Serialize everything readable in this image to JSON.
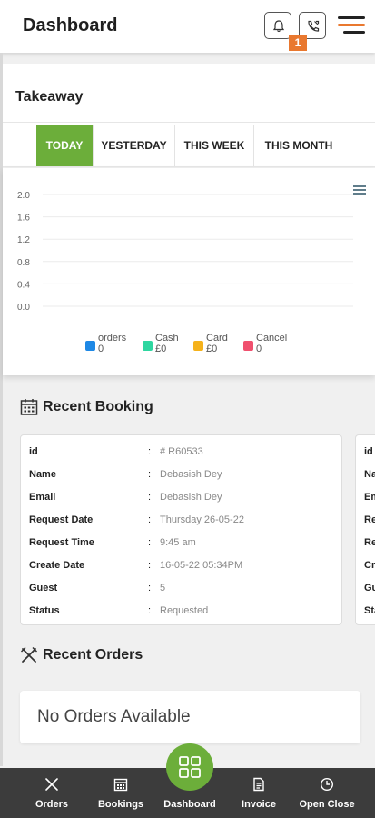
{
  "header": {
    "title": "Dashboard",
    "notification_icon": "bell-icon",
    "phone_icon": "phone-icon",
    "notification_badge": "1",
    "menu_icon": "hamburger-menu-icon"
  },
  "takeaway": {
    "label": "Takeaway",
    "tabs": [
      {
        "label": "TODAY",
        "active": true
      },
      {
        "label": "YESTERDAY",
        "active": false
      },
      {
        "label": "THIS WEEK",
        "active": false
      },
      {
        "label": "THIS MONTH",
        "active": false
      }
    ]
  },
  "chart_data": {
    "type": "bar",
    "title": "",
    "xlabel": "",
    "ylabel": "",
    "yticks": [
      "2.0",
      "1.6",
      "1.2",
      "0.8",
      "0.4",
      "0.0"
    ],
    "ylim": [
      0,
      2.0
    ],
    "grid": true,
    "legend_placement": "bottom",
    "series": [
      {
        "name": "orders",
        "value_label": "0",
        "color": "#1e88e5"
      },
      {
        "name": "Cash",
        "value_label": "£0",
        "color": "#2ed6a0"
      },
      {
        "name": "Card",
        "value_label": "£0",
        "color": "#f5b21b"
      },
      {
        "name": "Cancel",
        "value_label": "0",
        "color": "#f0506e"
      }
    ]
  },
  "recent_booking": {
    "title": "Recent Booking",
    "icon": "calendar-icon",
    "separator": ":",
    "cards": [
      {
        "rows": [
          {
            "key": "id",
            "value": "# R60533"
          },
          {
            "key": "Name",
            "value": "Debasish Dey"
          },
          {
            "key": "Email",
            "value": "Debasish Dey"
          },
          {
            "key": "Request Date",
            "value": "Thursday 26-05-22"
          },
          {
            "key": "Request Time",
            "value": "9:45 am"
          },
          {
            "key": "Create Date",
            "value": "16-05-22 05:34PM"
          },
          {
            "key": "Guest",
            "value": "5"
          },
          {
            "key": "Status",
            "value": "Requested"
          }
        ]
      },
      {
        "rows": [
          {
            "key": "id"
          },
          {
            "key": "Na"
          },
          {
            "key": "Em"
          },
          {
            "key": "Re"
          },
          {
            "key": "Re"
          },
          {
            "key": "Cr"
          },
          {
            "key": "Gu"
          },
          {
            "key": "Sta"
          }
        ]
      }
    ]
  },
  "recent_orders": {
    "title": "Recent Orders",
    "icon": "fork-knife-icon",
    "empty_text": "No Orders Available"
  },
  "bottom_nav": {
    "items": [
      {
        "label": "Orders",
        "icon": "fork-knife-icon"
      },
      {
        "label": "Bookings",
        "icon": "calendar-icon"
      },
      {
        "label": "Dashboard",
        "icon": "grid-icon"
      },
      {
        "label": "Invoice",
        "icon": "invoice-icon"
      },
      {
        "label": "Open Close",
        "icon": "clock-icon"
      }
    ]
  }
}
